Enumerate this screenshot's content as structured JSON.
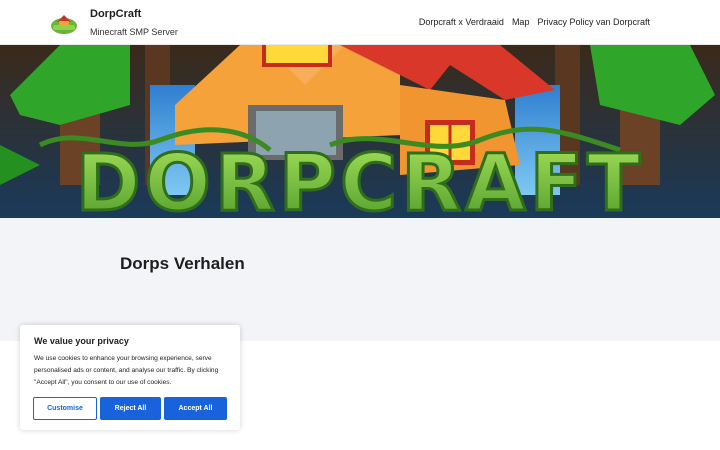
{
  "header": {
    "site_title": "DorpCraft",
    "tagline": "Minecraft SMP Server",
    "nav": [
      {
        "label": "Dorpcraft x Verdraaid"
      },
      {
        "label": "Map"
      },
      {
        "label": "Privacy Policy van Dorpcraft"
      }
    ]
  },
  "banner": {
    "logo_text": "DORPCRAFT"
  },
  "page": {
    "title": "Dorps Verhalen"
  },
  "cookie_banner": {
    "title": "We value your privacy",
    "text": "We use cookies to enhance your browsing experience, serve personalised ads or content, and analyse our traffic. By clicking \"Accept All\", you consent to our use of cookies.",
    "customise_label": "Customise",
    "reject_label": "Reject All",
    "accept_label": "Accept All"
  },
  "colors": {
    "accent": "#1863dc",
    "title_band": "#f2f4f7",
    "banner_green": "#7ac943"
  }
}
